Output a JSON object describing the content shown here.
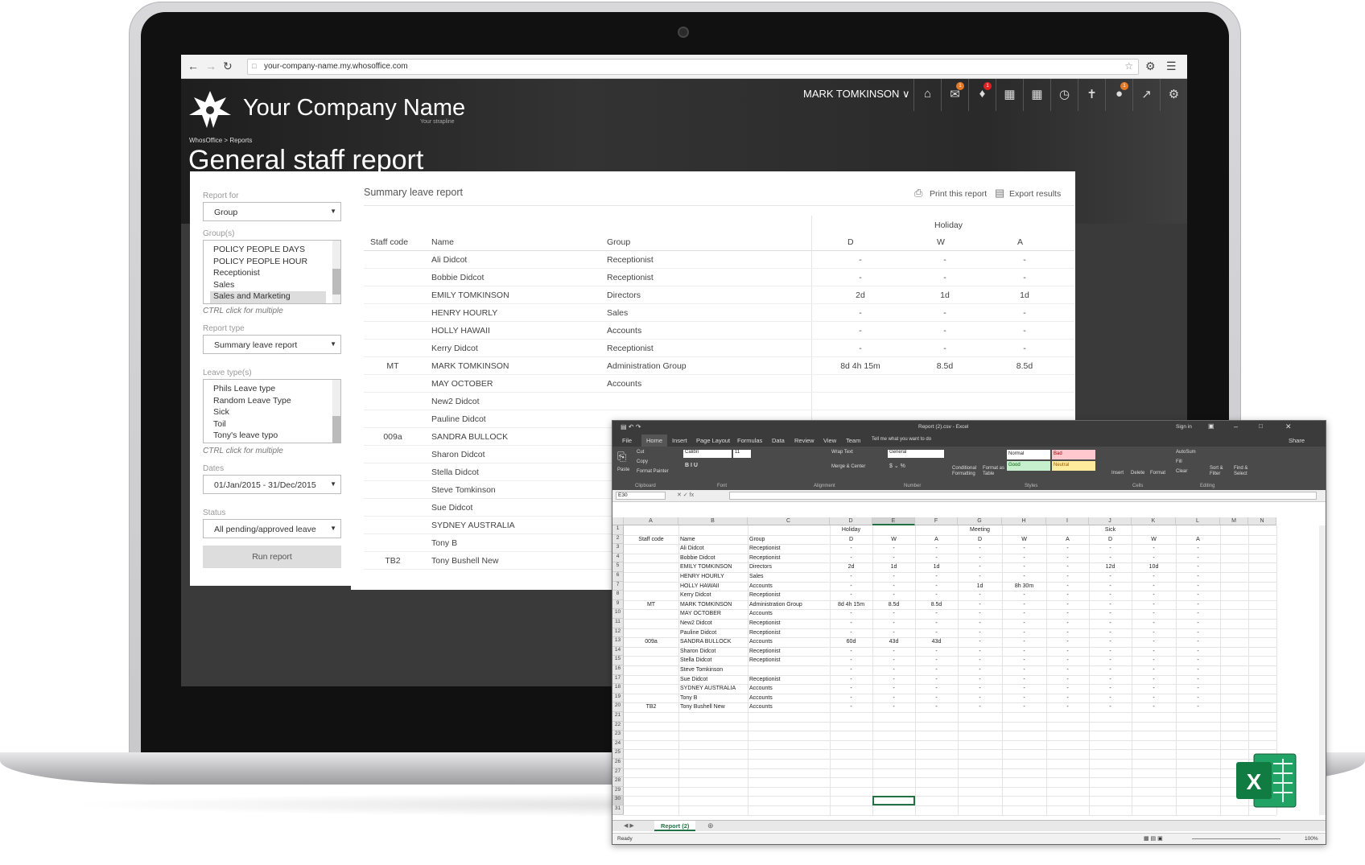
{
  "browser": {
    "url": "your-company-name.my.whosoffice.com"
  },
  "header": {
    "company": "Your Company Name",
    "strapline": "Your strapline",
    "breadcrumb": "WhosOffice > Reports",
    "page_title": "General staff report",
    "user": "MARK TOMKINSON ∨",
    "badges": [
      "1",
      "1",
      "1",
      "1"
    ]
  },
  "form": {
    "report_for_label": "Report for",
    "report_for_value": "Group",
    "groups_label": "Group(s)",
    "groups": [
      "POLICY PEOPLE DAYS",
      "POLICY PEOPLE HOUR",
      "Receptionist",
      "Sales",
      "Sales and Marketing"
    ],
    "groups_hint": "CTRL click for multiple",
    "report_type_label": "Report type",
    "report_type_value": "Summary leave report",
    "leave_types_label": "Leave type(s)",
    "leave_types": [
      "Phils Leave type",
      "Random Leave Type",
      "Sick",
      "Toil",
      "Tony's leave typo"
    ],
    "leave_hint": "CTRL click for multiple",
    "dates_label": "Dates",
    "dates_value": "01/Jan/2015 - 31/Dec/2015",
    "status_label": "Status",
    "status_value": "All pending/approved leave",
    "run_button": "Run report"
  },
  "report": {
    "title": "Summary leave report",
    "print": "Print this report",
    "export": "Export results",
    "group_header": "Holiday",
    "columns": [
      "Staff code",
      "Name",
      "Group",
      "D",
      "W",
      "A"
    ],
    "rows": [
      [
        "",
        "Ali Didcot",
        "Receptionist",
        "-",
        "-",
        "-"
      ],
      [
        "",
        "Bobbie Didcot",
        "Receptionist",
        "-",
        "-",
        "-"
      ],
      [
        "",
        "EMILY TOMKINSON",
        "Directors",
        "2d",
        "1d",
        "1d"
      ],
      [
        "",
        "HENRY HOURLY",
        "Sales",
        "-",
        "-",
        "-"
      ],
      [
        "",
        "HOLLY HAWAII",
        "Accounts",
        "-",
        "-",
        "-"
      ],
      [
        "",
        "Kerry Didcot",
        "Receptionist",
        "-",
        "-",
        "-"
      ],
      [
        "MT",
        "MARK TOMKINSON",
        "Administration Group",
        "8d 4h 15m",
        "8.5d",
        "8.5d"
      ],
      [
        "",
        "MAY OCTOBER",
        "Accounts",
        "",
        "",
        ""
      ],
      [
        "",
        "New2 Didcot",
        "",
        "",
        "",
        ""
      ],
      [
        "",
        "Pauline Didcot",
        "",
        "",
        "",
        ""
      ],
      [
        "009a",
        "SANDRA BULLOCK",
        "",
        "",
        "",
        ""
      ],
      [
        "",
        "Sharon Didcot",
        "",
        "",
        "",
        ""
      ],
      [
        "",
        "Stella Didcot",
        "",
        "",
        "",
        ""
      ],
      [
        "",
        "Steve Tomkinson",
        "",
        "",
        "",
        ""
      ],
      [
        "",
        "Sue Didcot",
        "",
        "",
        "",
        ""
      ],
      [
        "",
        "SYDNEY AUSTRALIA",
        "",
        "",
        "",
        ""
      ],
      [
        "",
        "Tony B",
        "",
        "",
        "",
        ""
      ],
      [
        "TB2",
        "Tony Bushell New",
        "",
        "",
        "",
        ""
      ]
    ]
  },
  "excel": {
    "title": "Report (2).csv - Excel",
    "signin": "Sign in",
    "tabs": [
      "File",
      "Home",
      "Insert",
      "Page Layout",
      "Formulas",
      "Data",
      "Review",
      "View",
      "Team"
    ],
    "tellme": "Tell me what you want to do",
    "share": "Share",
    "ribbon": {
      "clipboard": "Clipboard",
      "font": "Font",
      "alignment": "Alignment",
      "number": "Number",
      "styles": "Styles",
      "cells": "Cells",
      "editing": "Editing",
      "paste": "Paste",
      "cut": "Cut",
      "copy": "Copy",
      "format_painter": "Format Painter",
      "font_name": "Calibri",
      "font_size": "11",
      "wrap_text": "Wrap Text",
      "merge_center": "Merge & Center",
      "number_format": "General",
      "cond_fmt": "Conditional Formatting",
      "format_table": "Format as Table",
      "style_normal": "Normal",
      "style_bad": "Bad",
      "style_good": "Good",
      "style_neutral": "Neutral",
      "insert": "Insert",
      "delete": "Delete",
      "format": "Format",
      "autosum": "AutoSum",
      "fill": "Fill",
      "clear": "Clear",
      "sort_filter": "Sort & Filter",
      "find_select": "Find & Select"
    },
    "namebox": "E30",
    "col_letters": [
      "A",
      "B",
      "C",
      "D",
      "E",
      "F",
      "G",
      "H",
      "I",
      "J",
      "K",
      "L",
      "M",
      "N"
    ],
    "row1": [
      "",
      "",
      "",
      "Holiday",
      "",
      "",
      "Meeting",
      "",
      "",
      "Sick",
      "",
      "",
      "",
      ""
    ],
    "rows": [
      [
        "Staff code",
        "Name",
        "Group",
        "D",
        "W",
        "A",
        "D",
        "W",
        "A",
        "D",
        "W",
        "A"
      ],
      [
        "",
        "Ali Didcot",
        "Receptionist",
        "-",
        "-",
        "-",
        "-",
        "-",
        "-",
        "-",
        "-",
        "-"
      ],
      [
        "",
        "Bobbie Didcot",
        "Receptionist",
        "-",
        "-",
        "-",
        "-",
        "-",
        "-",
        "-",
        "-",
        "-"
      ],
      [
        "",
        "EMILY TOMKINSON",
        "Directors",
        "2d",
        "1d",
        "1d",
        "-",
        "-",
        "-",
        "12d",
        "10d",
        "-"
      ],
      [
        "",
        "HENRY HOURLY",
        "Sales",
        "-",
        "-",
        "-",
        "-",
        "-",
        "-",
        "-",
        "-",
        "-"
      ],
      [
        "",
        "HOLLY HAWAII",
        "Accounts",
        "-",
        "-",
        "-",
        "1d",
        "8h 30m",
        "-",
        "-",
        "-",
        "-"
      ],
      [
        "",
        "Kerry Didcot",
        "Receptionist",
        "-",
        "-",
        "-",
        "-",
        "-",
        "-",
        "-",
        "-",
        "-"
      ],
      [
        "MT",
        "MARK TOMKINSON",
        "Administration Group",
        "8d 4h 15m",
        "8.5d",
        "8.5d",
        "-",
        "-",
        "-",
        "-",
        "-",
        "-"
      ],
      [
        "",
        "MAY OCTOBER",
        "Accounts",
        "-",
        "-",
        "-",
        "-",
        "-",
        "-",
        "-",
        "-",
        "-"
      ],
      [
        "",
        "New2 Didcot",
        "Receptionist",
        "-",
        "-",
        "-",
        "-",
        "-",
        "-",
        "-",
        "-",
        "-"
      ],
      [
        "",
        "Pauline Didcot",
        "Receptionist",
        "-",
        "-",
        "-",
        "-",
        "-",
        "-",
        "-",
        "-",
        "-"
      ],
      [
        "009a",
        "SANDRA BULLOCK",
        "Accounts",
        "60d",
        "43d",
        "43d",
        "-",
        "-",
        "-",
        "-",
        "-",
        "-"
      ],
      [
        "",
        "Sharon Didcot",
        "Receptionist",
        "-",
        "-",
        "-",
        "-",
        "-",
        "-",
        "-",
        "-",
        "-"
      ],
      [
        "",
        "Stella Didcot",
        "Receptionist",
        "-",
        "-",
        "-",
        "-",
        "-",
        "-",
        "-",
        "-",
        "-"
      ],
      [
        "",
        "Steve Tomkinson",
        "",
        "-",
        "-",
        "-",
        "-",
        "-",
        "-",
        "-",
        "-",
        "-"
      ],
      [
        "",
        "Sue Didcot",
        "Receptionist",
        "-",
        "-",
        "-",
        "-",
        "-",
        "-",
        "-",
        "-",
        "-"
      ],
      [
        "",
        "SYDNEY AUSTRALIA",
        "Accounts",
        "-",
        "-",
        "-",
        "-",
        "-",
        "-",
        "-",
        "-",
        "-"
      ],
      [
        "",
        "Tony B",
        "Accounts",
        "-",
        "-",
        "-",
        "-",
        "-",
        "-",
        "-",
        "-",
        "-"
      ],
      [
        "TB2",
        "Tony Bushell New",
        "Accounts",
        "-",
        "-",
        "-",
        "-",
        "-",
        "-",
        "-",
        "-",
        "-"
      ]
    ],
    "row_count": 31,
    "sheet_tab": "Report (2)",
    "status": "Ready",
    "zoom": "100%"
  }
}
